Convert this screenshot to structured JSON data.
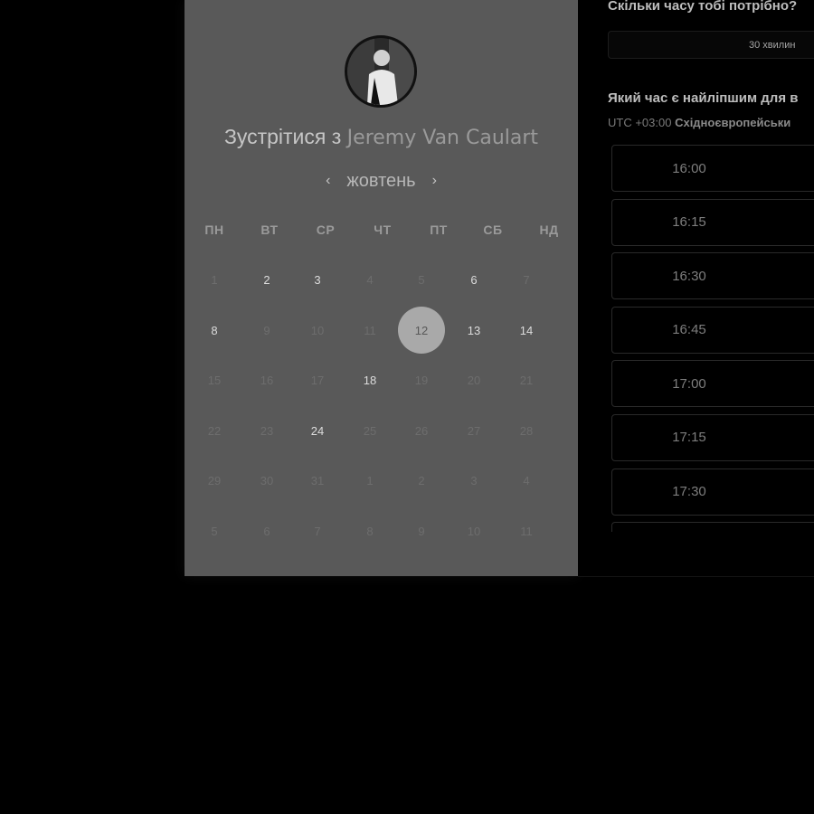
{
  "calendar": {
    "title_prefix": "Зустрітися з",
    "host_name": "Jeremy Van Caulart",
    "month": "жовтень",
    "prev_label": "‹",
    "next_label": "›",
    "weekdays": [
      "ПН",
      "ВТ",
      "СР",
      "ЧТ",
      "ПТ",
      "СБ",
      "НД"
    ],
    "weeks": [
      [
        {
          "d": "1"
        },
        {
          "d": "2",
          "a": true
        },
        {
          "d": "3",
          "a": true
        },
        {
          "d": "4"
        },
        {
          "d": "5"
        },
        {
          "d": "6",
          "a": true
        },
        {
          "d": "7"
        }
      ],
      [
        {
          "d": "8",
          "a": true
        },
        {
          "d": "9"
        },
        {
          "d": "10"
        },
        {
          "d": "11"
        },
        {
          "d": "12",
          "a": true,
          "s": true
        },
        {
          "d": "13",
          "a": true
        },
        {
          "d": "14",
          "a": true
        }
      ],
      [
        {
          "d": "15"
        },
        {
          "d": "16"
        },
        {
          "d": "17"
        },
        {
          "d": "18",
          "a": true
        },
        {
          "d": "19"
        },
        {
          "d": "20"
        },
        {
          "d": "21"
        }
      ],
      [
        {
          "d": "22"
        },
        {
          "d": "23"
        },
        {
          "d": "24",
          "a": true
        },
        {
          "d": "25"
        },
        {
          "d": "26"
        },
        {
          "d": "27"
        },
        {
          "d": "28"
        }
      ],
      [
        {
          "d": "29"
        },
        {
          "d": "30"
        },
        {
          "d": "31"
        },
        {
          "d": "1"
        },
        {
          "d": "2"
        },
        {
          "d": "3"
        },
        {
          "d": "4"
        }
      ],
      [
        {
          "d": "5"
        },
        {
          "d": "6"
        },
        {
          "d": "7"
        },
        {
          "d": "8"
        },
        {
          "d": "9"
        },
        {
          "d": "10"
        },
        {
          "d": "11"
        }
      ]
    ]
  },
  "booking": {
    "duration_question": "Скільки часу тобі потрібно?",
    "duration_value": "30 хвилин",
    "time_question": "Який час є найліпшим для в",
    "tz_offset": "UTC +03:00",
    "tz_name": "Східноєвропейськи",
    "slots": [
      "16:00",
      "16:15",
      "16:30",
      "16:45",
      "17:00",
      "17:15",
      "17:30",
      ""
    ]
  },
  "colors": {
    "panel": "#595959",
    "selected_day": "#a9a9a9",
    "background": "#000000"
  }
}
